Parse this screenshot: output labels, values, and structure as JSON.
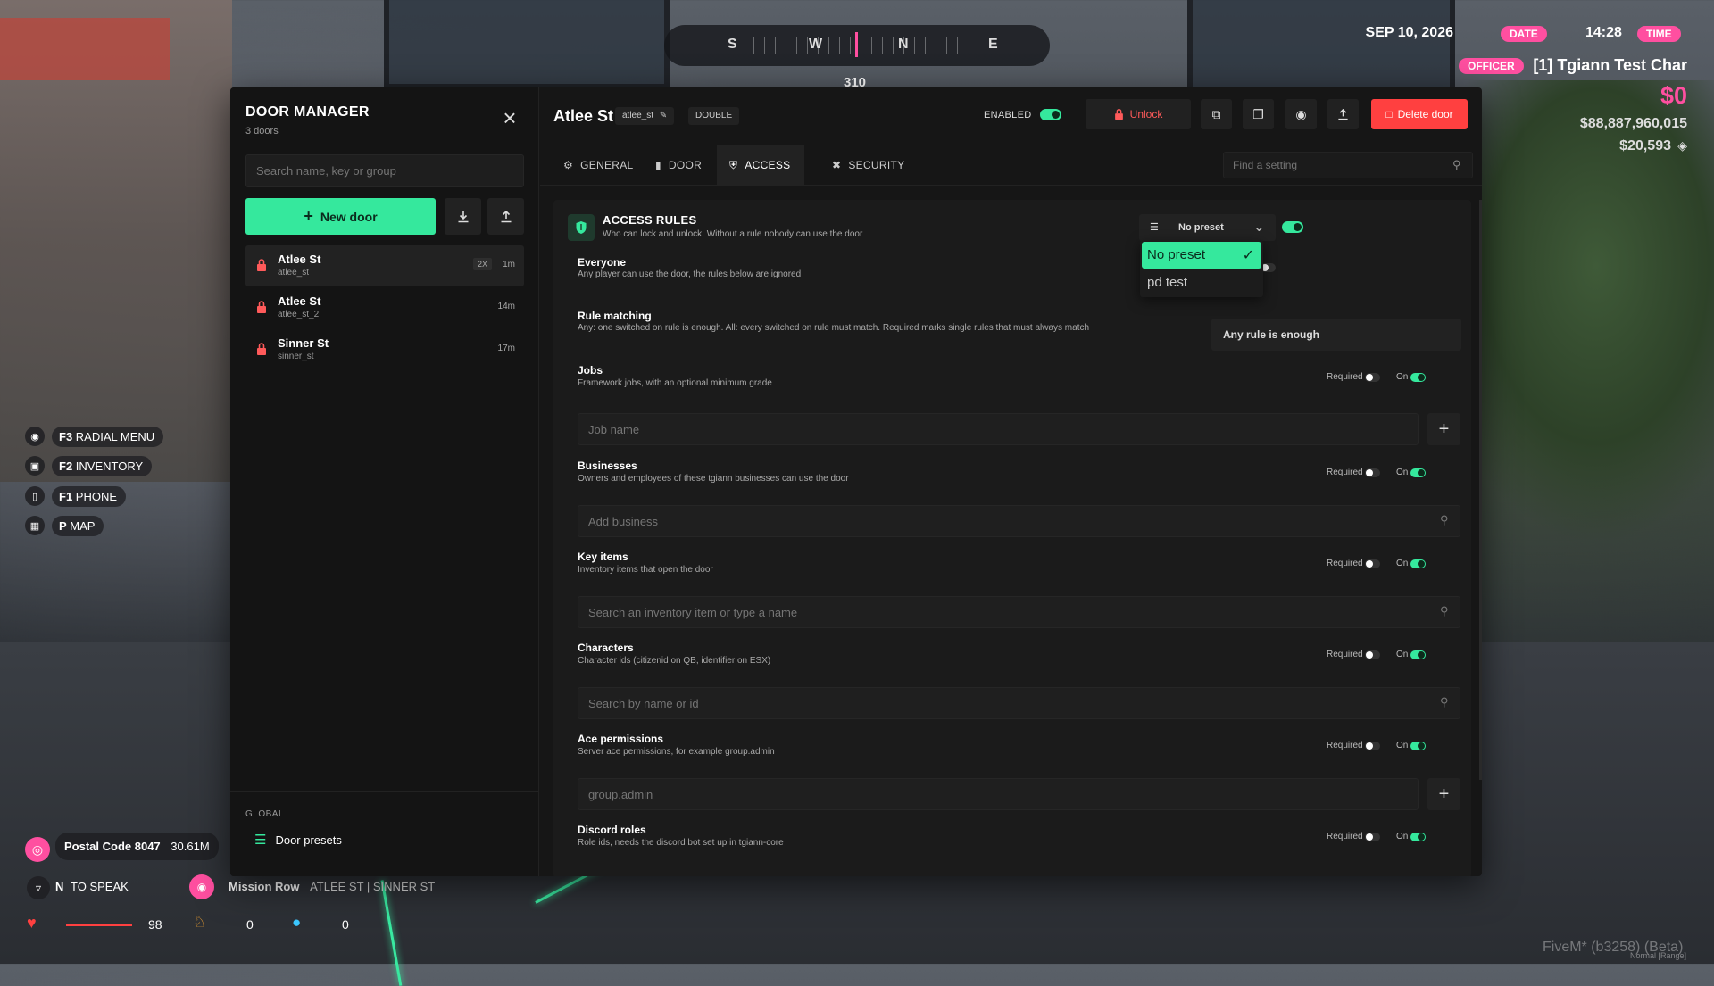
{
  "hud": {
    "compass": {
      "s": "S",
      "w": "W",
      "n": "N",
      "e": "E",
      "heading": "310"
    },
    "date": "SEP 10, 2026",
    "date_tag": "DATE",
    "time": "14:28",
    "time_tag": "TIME",
    "job_tag": "OFFICER",
    "character": "[1] Tgiann Test Char",
    "cash": "$0",
    "bank": "$88,887,960,015",
    "black_money": "$20,593",
    "hints": [
      {
        "key": "F3",
        "label": "RADIAL MENU"
      },
      {
        "key": "F2",
        "label": "INVENTORY"
      },
      {
        "key": "F1",
        "label": "PHONE"
      },
      {
        "key": "P",
        "label": "MAP"
      }
    ],
    "postal": "Postal Code 8047",
    "postal_dist": "30.61M",
    "voice_key": "N",
    "voice_label": "TO SPEAK",
    "location": "Mission Row",
    "streets": "ATLEE ST | SINNER ST",
    "health": "98",
    "hunger": "0",
    "thirst": "0",
    "build": "FiveM* (b3258) (Beta)",
    "build_sub": "Normal [Range]"
  },
  "sidebar": {
    "title": "DOOR MANAGER",
    "count": "3 doors",
    "search_placeholder": "Search name, key or group",
    "new_door": "New door",
    "doors": [
      {
        "name": "Atlee St",
        "key": "atlee_st",
        "badge": "2X",
        "time": "1m"
      },
      {
        "name": "Atlee St",
        "key": "atlee_st_2",
        "time": "14m"
      },
      {
        "name": "Sinner St",
        "key": "sinner_st",
        "time": "17m"
      }
    ],
    "global_label": "GLOBAL",
    "presets": "Door presets"
  },
  "main": {
    "title": "Atlee St",
    "key_tag": "atlee_st",
    "type_tag": "DOUBLE",
    "enabled_label": "ENABLED",
    "unlock": "Unlock",
    "delete": "Delete door",
    "tabs": [
      "GENERAL",
      "DOOR",
      "ACCESS",
      "SECURITY"
    ],
    "find_placeholder": "Find a setting"
  },
  "access": {
    "title": "ACCESS RULES",
    "subtitle": "Who can lock and unlock. Without a rule nobody can use the door",
    "preset_value": "No preset",
    "preset_options": [
      "No preset",
      "pd test"
    ],
    "everyone_title": "Everyone",
    "everyone_desc": "Any player can use the door, the rules below are ignored",
    "matching_title": "Rule matching",
    "matching_desc": "Any: one switched on rule is enough. All: every switched on rule must match. Required marks single rules that must always match",
    "matching_value": "Any rule is enough",
    "required_label": "Required",
    "on_label": "On",
    "rules": [
      {
        "title": "Jobs",
        "desc": "Framework jobs, with an optional minimum grade",
        "placeholder": "Job name"
      },
      {
        "title": "Businesses",
        "desc": "Owners and employees of these tgiann businesses can use the door",
        "placeholder": "Add business"
      },
      {
        "title": "Key items",
        "desc": "Inventory items that open the door",
        "placeholder": "Search an inventory item or type a name"
      },
      {
        "title": "Characters",
        "desc": "Character ids (citizenid on QB, identifier on ESX)",
        "placeholder": "Search by name or id"
      },
      {
        "title": "Ace permissions",
        "desc": "Server ace permissions, for example group.admin",
        "placeholder": "group.admin"
      },
      {
        "title": "Discord roles",
        "desc": "Role ids, needs the discord bot set up in tgiann-core",
        "placeholder": ""
      }
    ]
  },
  "colors": {
    "accent": "#35e89d",
    "danger": "#ff4040",
    "hud_pink": "#ff4fa0"
  }
}
